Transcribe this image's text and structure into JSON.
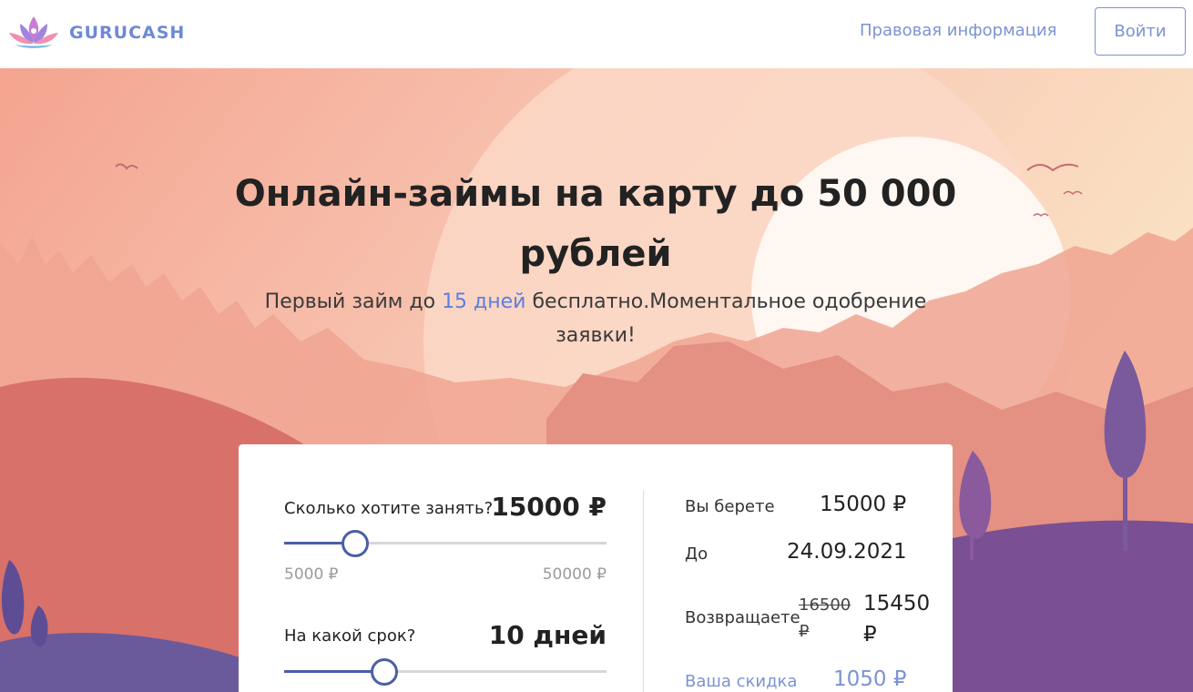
{
  "header": {
    "brand": "GURUCASH",
    "legal_link": "Правовая информация",
    "login_button": "Войти"
  },
  "hero": {
    "title": "Онлайн-займы на карту до 50 000 рублей",
    "subtitle_before": "Первый займ до ",
    "subtitle_accent": "15 дней",
    "subtitle_after": " бесплатно.Моментальное одобрение заявки!"
  },
  "calculator": {
    "amount": {
      "label": "Сколько хотите занять?",
      "value": "15000 ₽",
      "min_label": "5000 ₽",
      "max_label": "50000 ₽",
      "fraction": 0.22
    },
    "term": {
      "label": "На какой срок?",
      "value": "10 дней",
      "fraction": 0.31
    },
    "summary": {
      "take_label": "Вы берете",
      "take_value": "15000 ₽",
      "until_label": "До",
      "until_value": "24.09.2021",
      "return_label": "Возвращаете",
      "old_amount": "16500 ₽",
      "new_amount": "15450 ₽",
      "discount_label": "Ваша скидка",
      "discount_value": "1050 ₽"
    }
  },
  "colors": {
    "brand": "#6e88d6",
    "slider": "#4c5ea5",
    "accent": "#5b7ee0"
  }
}
